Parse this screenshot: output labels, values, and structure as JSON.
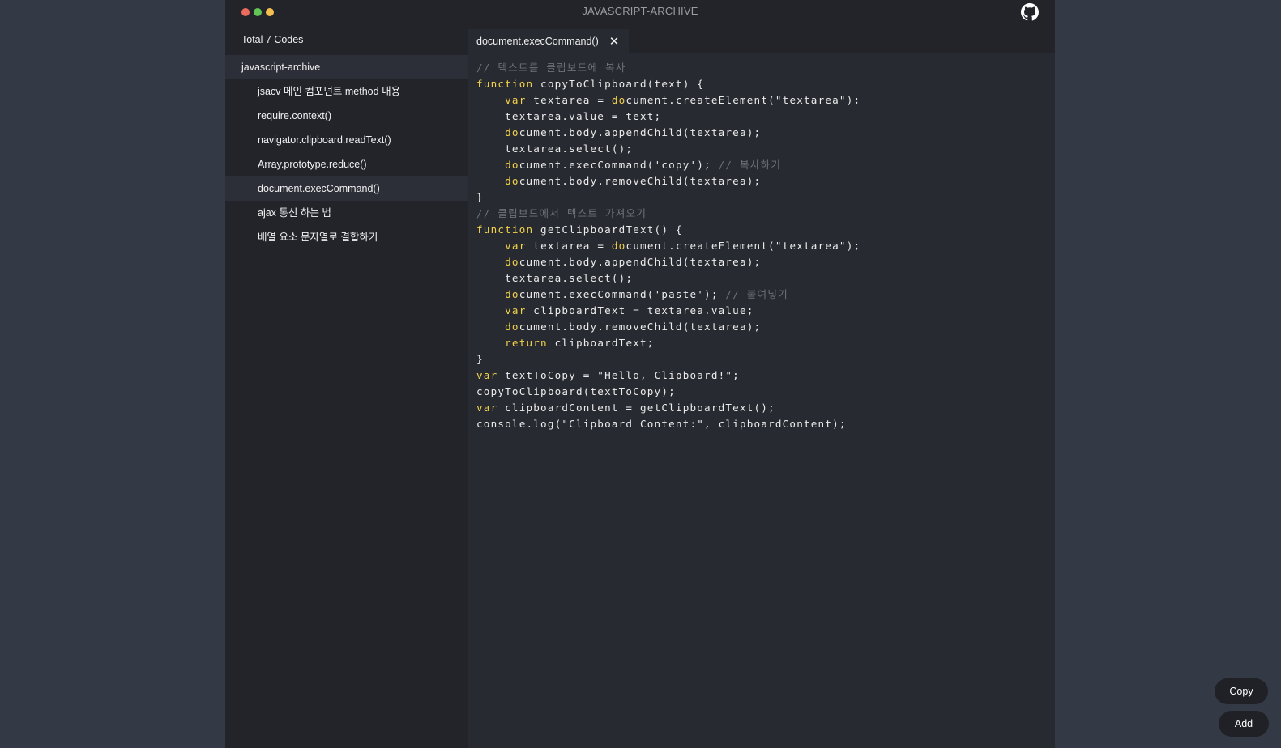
{
  "window": {
    "title": "JAVASCRIPT-ARCHIVE",
    "github_icon": "github-icon"
  },
  "sidebar": {
    "total_label": "Total 7 Codes",
    "folder_label": "javascript-archive",
    "items": [
      {
        "label": "jsacv 메인 컴포넌트 method 내용",
        "active": false
      },
      {
        "label": "require.context()",
        "active": false
      },
      {
        "label": "navigator.clipboard.readText()",
        "active": false
      },
      {
        "label": "Array.prototype.reduce()",
        "active": false
      },
      {
        "label": "document.execCommand()",
        "active": true
      },
      {
        "label": "ajax 통신 하는 법",
        "active": false
      },
      {
        "label": "배열 요소 문자열로 결합하기",
        "active": false
      }
    ]
  },
  "editor": {
    "tab_label": "document.execCommand()",
    "close_icon": "close-icon",
    "code_lines": [
      [
        {
          "t": "// 텍스트를 클립보드에 복사",
          "c": "cm"
        }
      ],
      [
        {
          "t": "function",
          "c": "kw"
        },
        {
          "t": " copyToClipboard(text) {"
        }
      ],
      [
        {
          "t": "    "
        },
        {
          "t": "var",
          "c": "kw"
        },
        {
          "t": " textarea = "
        },
        {
          "t": "do",
          "c": "kw"
        },
        {
          "t": "cument.createElement(\"textarea\");"
        }
      ],
      [
        {
          "t": "    textarea.value = text;"
        }
      ],
      [
        {
          "t": "    "
        },
        {
          "t": "do",
          "c": "kw"
        },
        {
          "t": "cument.body.appendChild(textarea);"
        }
      ],
      [
        {
          "t": "    textarea.select();"
        }
      ],
      [
        {
          "t": "    "
        },
        {
          "t": "do",
          "c": "kw"
        },
        {
          "t": "cument.execCommand('copy'); "
        },
        {
          "t": "// 복사하기",
          "c": "cm"
        }
      ],
      [
        {
          "t": "    "
        },
        {
          "t": "do",
          "c": "kw"
        },
        {
          "t": "cument.body.removeChild(textarea);"
        }
      ],
      [
        {
          "t": "}"
        }
      ],
      [
        {
          "t": "// 클립보드에서 텍스트 가져오기",
          "c": "cm"
        }
      ],
      [
        {
          "t": "function",
          "c": "kw"
        },
        {
          "t": " getClipboardText() {"
        }
      ],
      [
        {
          "t": "    "
        },
        {
          "t": "var",
          "c": "kw"
        },
        {
          "t": " textarea = "
        },
        {
          "t": "do",
          "c": "kw"
        },
        {
          "t": "cument.createElement(\"textarea\");"
        }
      ],
      [
        {
          "t": "    "
        },
        {
          "t": "do",
          "c": "kw"
        },
        {
          "t": "cument.body.appendChild(textarea);"
        }
      ],
      [
        {
          "t": "    textarea.select();"
        }
      ],
      [
        {
          "t": "    "
        },
        {
          "t": "do",
          "c": "kw"
        },
        {
          "t": "cument.execCommand('paste'); "
        },
        {
          "t": "// 붙여넣기",
          "c": "cm"
        }
      ],
      [
        {
          "t": "    "
        },
        {
          "t": "var",
          "c": "kw"
        },
        {
          "t": " clipboardText = textarea.value;"
        }
      ],
      [
        {
          "t": "    "
        },
        {
          "t": "do",
          "c": "kw"
        },
        {
          "t": "cument.body.removeChild(textarea);"
        }
      ],
      [
        {
          "t": "    "
        },
        {
          "t": "return",
          "c": "kw"
        },
        {
          "t": " clipboardText;"
        }
      ],
      [
        {
          "t": "}"
        }
      ],
      [
        {
          "t": "var",
          "c": "kw"
        },
        {
          "t": " textToCopy = \"Hello, Clipboard!\";"
        }
      ],
      [
        {
          "t": "copyToClipboard(textToCopy);"
        }
      ],
      [
        {
          "t": "var",
          "c": "kw"
        },
        {
          "t": " clipboardContent = getClipboardText();"
        }
      ],
      [
        {
          "t": "console.log(\"Clipboard Content:\", clipboardContent);"
        }
      ]
    ]
  },
  "actions": {
    "copy_label": "Copy",
    "add_label": "Add"
  },
  "colors": {
    "page_bg": "#343a45",
    "app_bg": "#22242a",
    "editor_bg": "#282a31",
    "active_item_bg": "#2c2f37",
    "keyword": "#f2d24b",
    "comment": "#6d7079",
    "close_dot": "#ec6a5e",
    "min_dot": "#61c454",
    "max_dot": "#f4bf4f"
  }
}
